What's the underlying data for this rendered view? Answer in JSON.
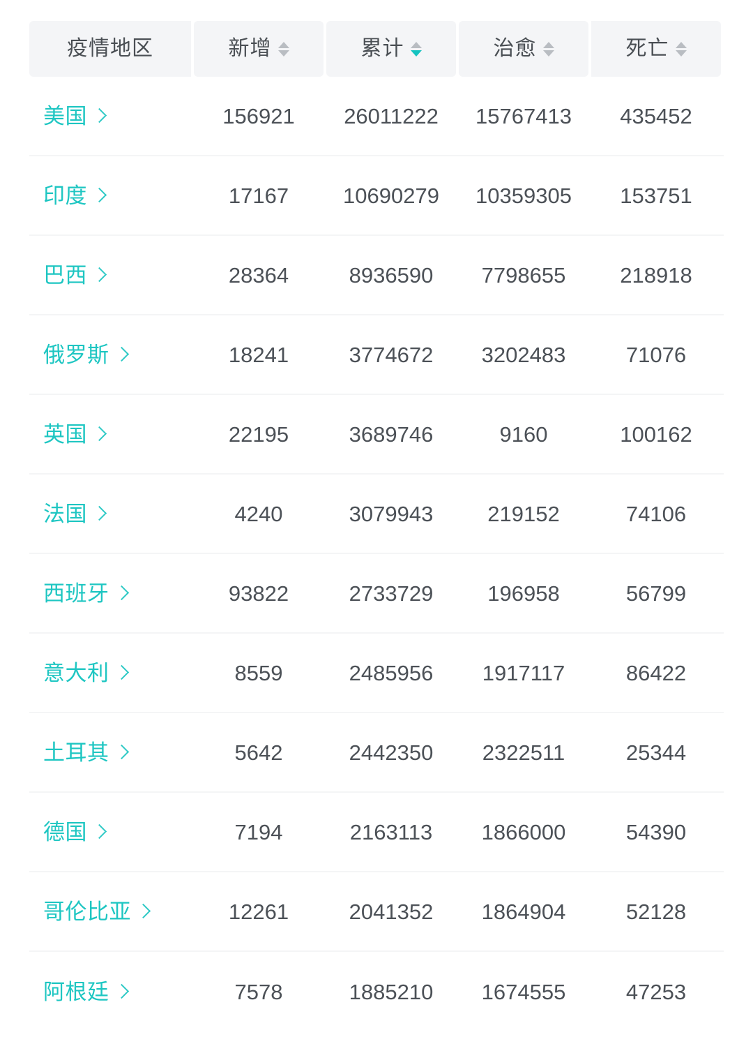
{
  "table": {
    "columns": [
      {
        "key": "region",
        "label": "疫情地区",
        "sort": "none",
        "sortable": false
      },
      {
        "key": "new",
        "label": "新增",
        "sort": "none",
        "sortable": true
      },
      {
        "key": "confirmed",
        "label": "累计",
        "sort": "desc",
        "sortable": true
      },
      {
        "key": "cured",
        "label": "治愈",
        "sort": "none",
        "sortable": true
      },
      {
        "key": "deaths",
        "label": "死亡",
        "sort": "none",
        "sortable": true
      }
    ],
    "rows": [
      {
        "region": "美国",
        "new": "156921",
        "confirmed": "26011222",
        "cured": "15767413",
        "deaths": "435452"
      },
      {
        "region": "印度",
        "new": "17167",
        "confirmed": "10690279",
        "cured": "10359305",
        "deaths": "153751"
      },
      {
        "region": "巴西",
        "new": "28364",
        "confirmed": "8936590",
        "cured": "7798655",
        "deaths": "218918"
      },
      {
        "region": "俄罗斯",
        "new": "18241",
        "confirmed": "3774672",
        "cured": "3202483",
        "deaths": "71076"
      },
      {
        "region": "英国",
        "new": "22195",
        "confirmed": "3689746",
        "cured": "9160",
        "deaths": "100162"
      },
      {
        "region": "法国",
        "new": "4240",
        "confirmed": "3079943",
        "cured": "219152",
        "deaths": "74106"
      },
      {
        "region": "西班牙",
        "new": "93822",
        "confirmed": "2733729",
        "cured": "196958",
        "deaths": "56799"
      },
      {
        "region": "意大利",
        "new": "8559",
        "confirmed": "2485956",
        "cured": "1917117",
        "deaths": "86422"
      },
      {
        "region": "土耳其",
        "new": "5642",
        "confirmed": "2442350",
        "cured": "2322511",
        "deaths": "25344"
      },
      {
        "region": "德国",
        "new": "7194",
        "confirmed": "2163113",
        "cured": "1866000",
        "deaths": "54390"
      },
      {
        "region": "哥伦比亚",
        "new": "12261",
        "confirmed": "2041352",
        "cured": "1864904",
        "deaths": "52128"
      },
      {
        "region": "阿根廷",
        "new": "7578",
        "confirmed": "1885210",
        "cured": "1674555",
        "deaths": "47253"
      }
    ]
  },
  "icons": {
    "sort": "sort-arrows-icon",
    "chevron": "chevron-right-icon"
  },
  "colors": {
    "accent": "#1ec6c2",
    "sort_active": "#15c3c0",
    "sort_inactive": "#b9bdc2",
    "header_bg": "#f4f5f7",
    "header_text": "#4a4f54",
    "number_text": "#4c5157",
    "row_divider": "#f4f5f6",
    "page_bg": "#ffffff"
  }
}
